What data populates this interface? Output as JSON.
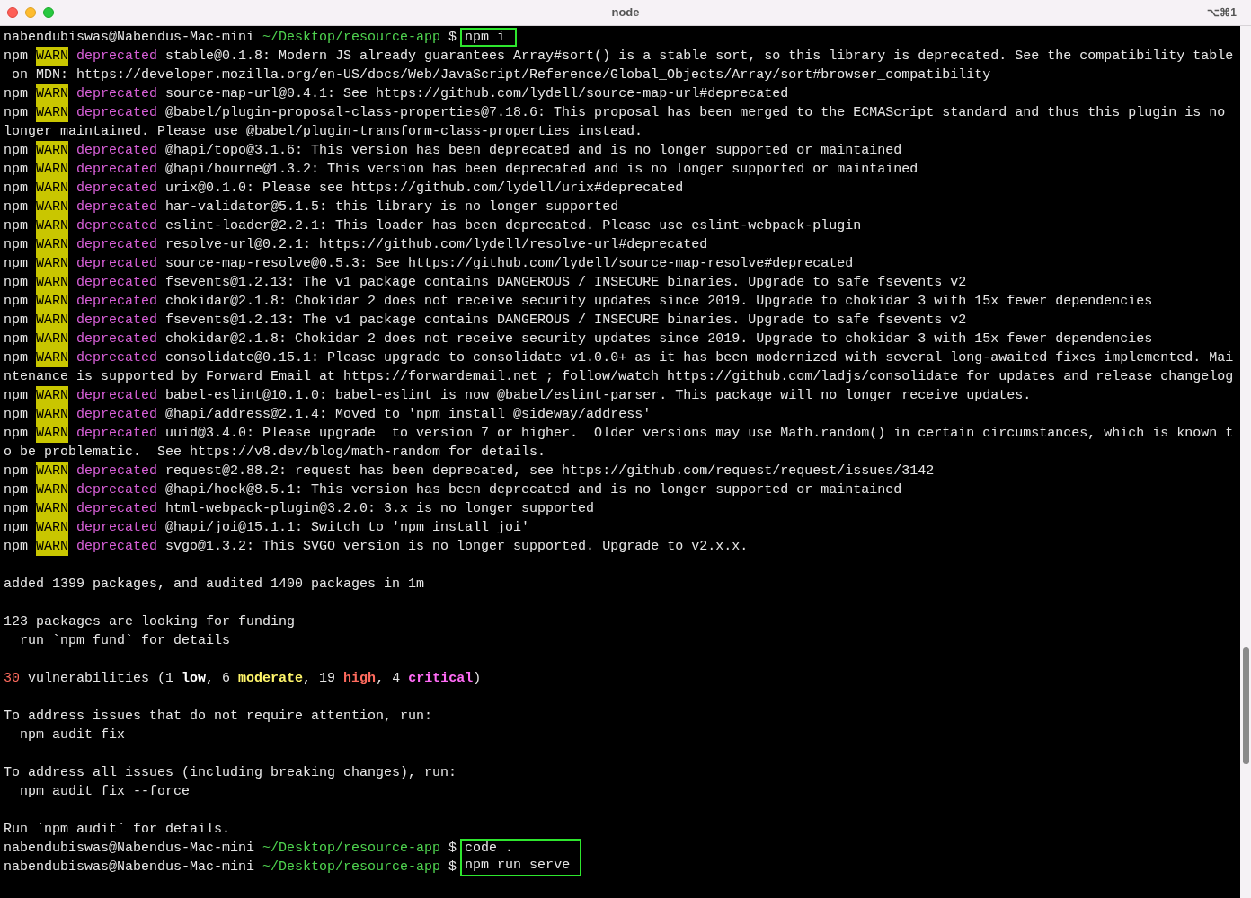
{
  "window": {
    "title": "node",
    "shortcut": "⌥⌘1"
  },
  "lines": [
    {
      "kind": "prompt",
      "user": "nabendubiswas@Nabendus-Mac-mini",
      "path": "~/Desktop/resource-app",
      "symbol": "$",
      "command": "npm i",
      "boxed": true
    },
    {
      "kind": "warn",
      "prefix": "npm",
      "badge": "WARN",
      "tag": "deprecated",
      "text": "stable@0.1.8: Modern JS already guarantees Array#sort() is a stable sort, so this library is deprecated. See the compatibility table"
    },
    {
      "kind": "plain",
      "text": " on MDN: https://developer.mozilla.org/en-US/docs/Web/JavaScript/Reference/Global_Objects/Array/sort#browser_compatibility"
    },
    {
      "kind": "warn",
      "prefix": "npm",
      "badge": "WARN",
      "tag": "deprecated",
      "text": "source-map-url@0.4.1: See https://github.com/lydell/source-map-url#deprecated"
    },
    {
      "kind": "warn",
      "prefix": "npm",
      "badge": "WARN",
      "tag": "deprecated",
      "text": "@babel/plugin-proposal-class-properties@7.18.6: This proposal has been merged to the ECMAScript standard and thus this plugin is no"
    },
    {
      "kind": "plain",
      "text": "longer maintained. Please use @babel/plugin-transform-class-properties instead."
    },
    {
      "kind": "warn",
      "prefix": "npm",
      "badge": "WARN",
      "tag": "deprecated",
      "text": "@hapi/topo@3.1.6: This version has been deprecated and is no longer supported or maintained"
    },
    {
      "kind": "warn",
      "prefix": "npm",
      "badge": "WARN",
      "tag": "deprecated",
      "text": "@hapi/bourne@1.3.2: This version has been deprecated and is no longer supported or maintained"
    },
    {
      "kind": "warn",
      "prefix": "npm",
      "badge": "WARN",
      "tag": "deprecated",
      "text": "urix@0.1.0: Please see https://github.com/lydell/urix#deprecated"
    },
    {
      "kind": "warn",
      "prefix": "npm",
      "badge": "WARN",
      "tag": "deprecated",
      "text": "har-validator@5.1.5: this library is no longer supported"
    },
    {
      "kind": "warn",
      "prefix": "npm",
      "badge": "WARN",
      "tag": "deprecated",
      "text": "eslint-loader@2.2.1: This loader has been deprecated. Please use eslint-webpack-plugin"
    },
    {
      "kind": "warn",
      "prefix": "npm",
      "badge": "WARN",
      "tag": "deprecated",
      "text": "resolve-url@0.2.1: https://github.com/lydell/resolve-url#deprecated"
    },
    {
      "kind": "warn",
      "prefix": "npm",
      "badge": "WARN",
      "tag": "deprecated",
      "text": "source-map-resolve@0.5.3: See https://github.com/lydell/source-map-resolve#deprecated"
    },
    {
      "kind": "warn",
      "prefix": "npm",
      "badge": "WARN",
      "tag": "deprecated",
      "text": "fsevents@1.2.13: The v1 package contains DANGEROUS / INSECURE binaries. Upgrade to safe fsevents v2"
    },
    {
      "kind": "warn",
      "prefix": "npm",
      "badge": "WARN",
      "tag": "deprecated",
      "text": "chokidar@2.1.8: Chokidar 2 does not receive security updates since 2019. Upgrade to chokidar 3 with 15x fewer dependencies"
    },
    {
      "kind": "warn",
      "prefix": "npm",
      "badge": "WARN",
      "tag": "deprecated",
      "text": "fsevents@1.2.13: The v1 package contains DANGEROUS / INSECURE binaries. Upgrade to safe fsevents v2"
    },
    {
      "kind": "warn",
      "prefix": "npm",
      "badge": "WARN",
      "tag": "deprecated",
      "text": "chokidar@2.1.8: Chokidar 2 does not receive security updates since 2019. Upgrade to chokidar 3 with 15x fewer dependencies"
    },
    {
      "kind": "warn",
      "prefix": "npm",
      "badge": "WARN",
      "tag": "deprecated",
      "text": "consolidate@0.15.1: Please upgrade to consolidate v1.0.0+ as it has been modernized with several long-awaited fixes implemented. Mai"
    },
    {
      "kind": "plain",
      "text": "ntenance is supported by Forward Email at https://forwardemail.net ; follow/watch https://github.com/ladjs/consolidate for updates and release changelog"
    },
    {
      "kind": "warn",
      "prefix": "npm",
      "badge": "WARN",
      "tag": "deprecated",
      "text": "babel-eslint@10.1.0: babel-eslint is now @babel/eslint-parser. This package will no longer receive updates."
    },
    {
      "kind": "warn",
      "prefix": "npm",
      "badge": "WARN",
      "tag": "deprecated",
      "text": "@hapi/address@2.1.4: Moved to 'npm install @sideway/address'"
    },
    {
      "kind": "warn",
      "prefix": "npm",
      "badge": "WARN",
      "tag": "deprecated",
      "text": "uuid@3.4.0: Please upgrade  to version 7 or higher.  Older versions may use Math.random() in certain circumstances, which is known t"
    },
    {
      "kind": "plain",
      "text": "o be problematic.  See https://v8.dev/blog/math-random for details."
    },
    {
      "kind": "warn",
      "prefix": "npm",
      "badge": "WARN",
      "tag": "deprecated",
      "text": "request@2.88.2: request has been deprecated, see https://github.com/request/request/issues/3142"
    },
    {
      "kind": "warn",
      "prefix": "npm",
      "badge": "WARN",
      "tag": "deprecated",
      "text": "@hapi/hoek@8.5.1: This version has been deprecated and is no longer supported or maintained"
    },
    {
      "kind": "warn",
      "prefix": "npm",
      "badge": "WARN",
      "tag": "deprecated",
      "text": "html-webpack-plugin@3.2.0: 3.x is no longer supported"
    },
    {
      "kind": "warn",
      "prefix": "npm",
      "badge": "WARN",
      "tag": "deprecated",
      "text": "@hapi/joi@15.1.1: Switch to 'npm install joi'"
    },
    {
      "kind": "warn",
      "prefix": "npm",
      "badge": "WARN",
      "tag": "deprecated",
      "text": "svgo@1.3.2: This SVGO version is no longer supported. Upgrade to v2.x.x."
    },
    {
      "kind": "blank"
    },
    {
      "kind": "plain",
      "text": "added 1399 packages, and audited 1400 packages in 1m"
    },
    {
      "kind": "blank"
    },
    {
      "kind": "plain",
      "text": "123 packages are looking for funding"
    },
    {
      "kind": "plain",
      "text": "  run `npm fund` for details"
    },
    {
      "kind": "blank"
    },
    {
      "kind": "segments",
      "parts": [
        {
          "text": "30",
          "color": "#ff6b5e",
          "bold": false
        },
        {
          "text": " vulnerabilities (1 ",
          "bold": false
        },
        {
          "text": "low",
          "color": "#ffffff",
          "bold": true
        },
        {
          "text": ", 6 ",
          "bold": false
        },
        {
          "text": "moderate",
          "color": "#fff56a",
          "bold": true
        },
        {
          "text": ", 19 ",
          "bold": false
        },
        {
          "text": "high",
          "color": "#ff6b5e",
          "bold": true
        },
        {
          "text": ", 4 ",
          "bold": false
        },
        {
          "text": "critical",
          "color": "#ff6bf5",
          "bold": true
        },
        {
          "text": ")",
          "bold": false
        }
      ]
    },
    {
      "kind": "blank"
    },
    {
      "kind": "plain",
      "text": "To address issues that do not require attention, run:"
    },
    {
      "kind": "plain",
      "text": "  npm audit fix"
    },
    {
      "kind": "blank"
    },
    {
      "kind": "plain",
      "text": "To address all issues (including breaking changes), run:"
    },
    {
      "kind": "plain",
      "text": "  npm audit fix --force"
    },
    {
      "kind": "blank"
    },
    {
      "kind": "plain",
      "text": "Run `npm audit` for details."
    },
    {
      "kind": "prompt",
      "user": "nabendubiswas@Nabendus-Mac-mini",
      "path": "~/Desktop/resource-app",
      "symbol": "$",
      "command": "code .",
      "boxed": true
    },
    {
      "kind": "prompt",
      "user": "nabendubiswas@Nabendus-Mac-mini",
      "path": "~/Desktop/resource-app",
      "symbol": "$",
      "command": "npm run serve",
      "boxed": true
    }
  ]
}
